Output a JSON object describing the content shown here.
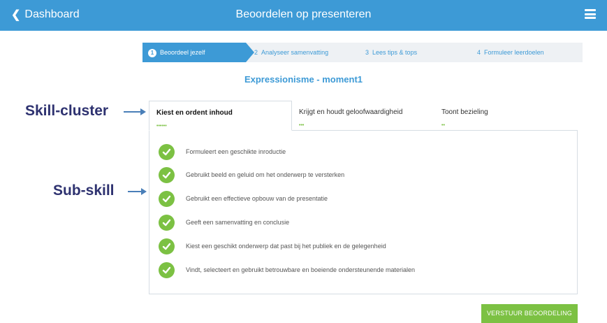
{
  "header": {
    "back_label": "Dashboard",
    "title": "Beoordelen op presenteren",
    "back_icon": "chevron-left-icon",
    "menu_icon": "hamburger-menu-icon"
  },
  "stepper": {
    "steps": [
      {
        "number": "1",
        "label": "Beoordeel jezelf",
        "active": true
      },
      {
        "number": "2",
        "label": "Analyseer samenvatting",
        "active": false
      },
      {
        "number": "3",
        "label": "Lees tips & tops",
        "active": false
      },
      {
        "number": "4",
        "label": "Formuleer leerdoelen",
        "active": false
      }
    ]
  },
  "subject": "Expressionisme - moment1",
  "annotations": {
    "skill_cluster": "Skill-cluster",
    "sub_skill": "Sub-skill"
  },
  "tabs": [
    {
      "label": "Kiest en ordent inhoud",
      "dots": "••••••",
      "active": true
    },
    {
      "label": "Krijgt en houdt geloofwaardigheid",
      "dots": "•••",
      "active": false
    },
    {
      "label": "Toont bezieling",
      "dots": "••",
      "active": false
    }
  ],
  "skills": [
    {
      "label": "Formuleert een geschikte inroductie",
      "checked": true
    },
    {
      "label": "Gebruikt beeld en geluid om het onderwerp te versterken",
      "checked": true
    },
    {
      "label": "Gebruikt een effectieve opbouw van de presentatie",
      "checked": true
    },
    {
      "label": "Geeft een samenvatting en conclusie",
      "checked": true
    },
    {
      "label": "Kiest een geschikt onderwerp dat past bij het publiek en de gelegenheid",
      "checked": true
    },
    {
      "label": "Vindt, selecteert en gebruikt betrouwbare en boeiende ondersteunende materialen",
      "checked": true
    }
  ],
  "submit_label": "VERSTUUR BEOORDELING",
  "colors": {
    "primary": "#3d9ad6",
    "success": "#7cc143",
    "annotation": "#2e3270"
  }
}
